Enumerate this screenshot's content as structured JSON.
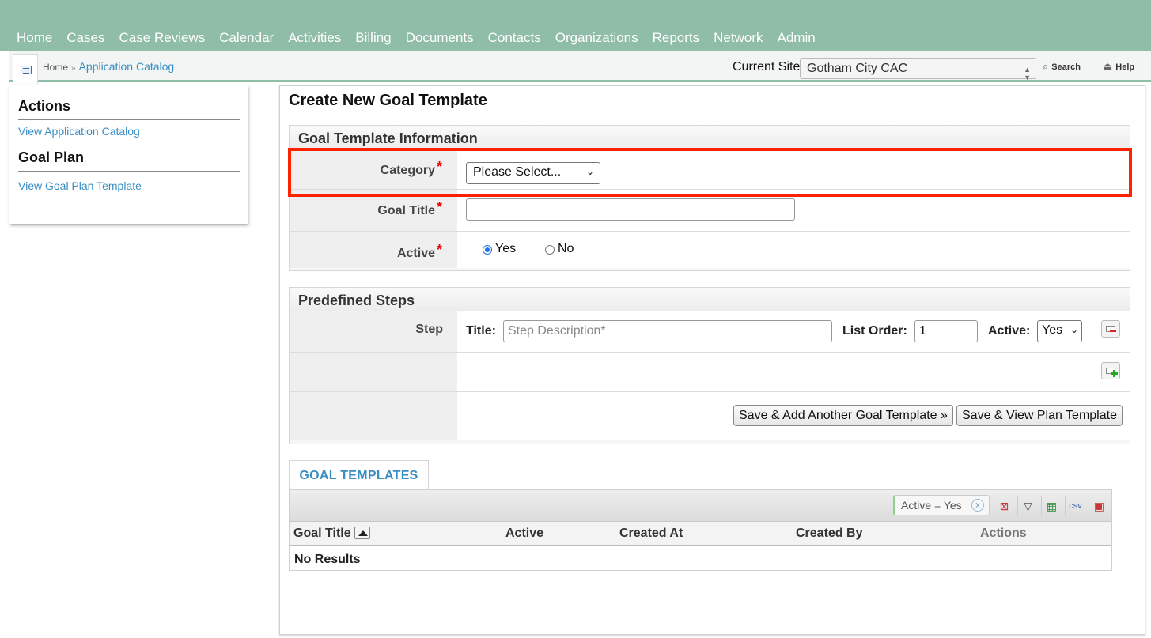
{
  "nav": {
    "items": [
      "Home",
      "Cases",
      "Case Reviews",
      "Calendar",
      "Activities",
      "Billing",
      "Documents",
      "Contacts",
      "Organizations",
      "Reports",
      "Network",
      "Admin"
    ]
  },
  "breadcrumb": {
    "home": "Home",
    "separator": "»",
    "current": "Application Catalog"
  },
  "site": {
    "label": "Current Site",
    "value": "Gotham City CAC",
    "search_label": "Search",
    "help_label": "Help"
  },
  "sidebar": {
    "actions_heading": "Actions",
    "actions_link": "View Application Catalog",
    "goal_plan_heading": "Goal Plan",
    "goal_plan_link": "View Goal Plan Template"
  },
  "page": {
    "title": "Create New Goal Template"
  },
  "goal_info": {
    "heading": "Goal Template Information",
    "category_label": "Category",
    "category_value": "Please Select...",
    "goal_title_label": "Goal Title",
    "goal_title_value": "",
    "active_label": "Active",
    "active_yes": "Yes",
    "active_no": "No",
    "required_mark": "*"
  },
  "steps": {
    "heading": "Predefined Steps",
    "step_label": "Step",
    "title_label": "Title:",
    "title_placeholder": "Step Description*",
    "list_order_label": "List Order:",
    "list_order_value": "1",
    "active_label": "Active:",
    "active_value": "Yes",
    "save_add_button": "Save & Add Another Goal Template »",
    "save_view_button": "Save & View Plan Template"
  },
  "grid": {
    "tab_label": "GOAL TEMPLATES",
    "filter_chip": "Active = Yes",
    "filter_remove": "x",
    "tool_csv": "csv",
    "columns": [
      "Goal Title",
      "Active",
      "Created At",
      "Created By",
      "Actions"
    ],
    "empty_text": "No Results"
  },
  "colors": {
    "nav_bg": "#8fbda7",
    "link": "#3a8ec2",
    "highlight": "#ff2200",
    "required": "#ee0000"
  }
}
